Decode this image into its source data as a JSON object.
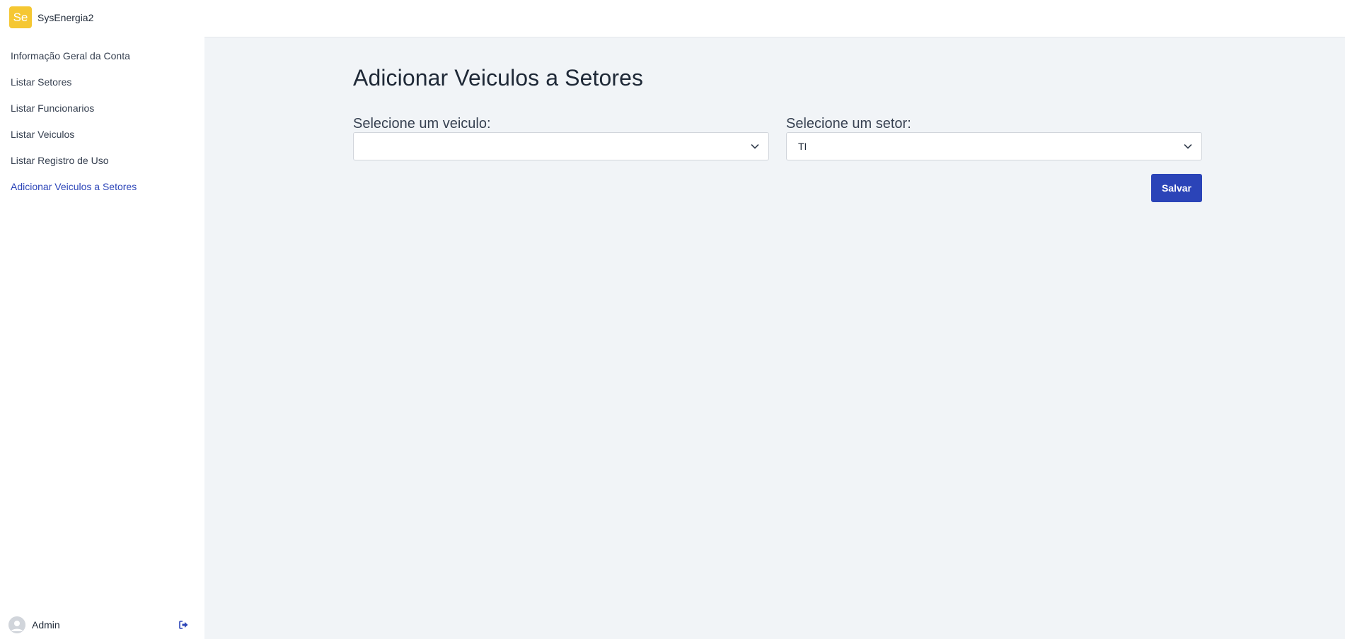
{
  "brand": {
    "logo_text": "Se",
    "name": "SysEnergia2",
    "logo_color": "#f5c732"
  },
  "sidebar": {
    "items": [
      {
        "label": "Informação Geral da Conta",
        "active": false
      },
      {
        "label": "Listar Setores",
        "active": false
      },
      {
        "label": "Listar Funcionarios",
        "active": false
      },
      {
        "label": "Listar Veiculos",
        "active": false
      },
      {
        "label": "Listar Registro de Uso",
        "active": false
      },
      {
        "label": "Adicionar Veiculos a Setores",
        "active": true
      }
    ],
    "user": {
      "name": "Admin",
      "avatar_icon": "user-avatar-icon",
      "logout_icon": "logout-icon"
    }
  },
  "main": {
    "title": "Adicionar Veiculos a Setores",
    "vehicle_field": {
      "label": "Selecione um veiculo:",
      "value": ""
    },
    "sector_field": {
      "label": "Selecione um setor:",
      "value": "TI"
    },
    "save_label": "Salvar"
  },
  "colors": {
    "accent": "#2b44b8",
    "main_background": "#f1f4f7",
    "logo": "#f5c732"
  }
}
